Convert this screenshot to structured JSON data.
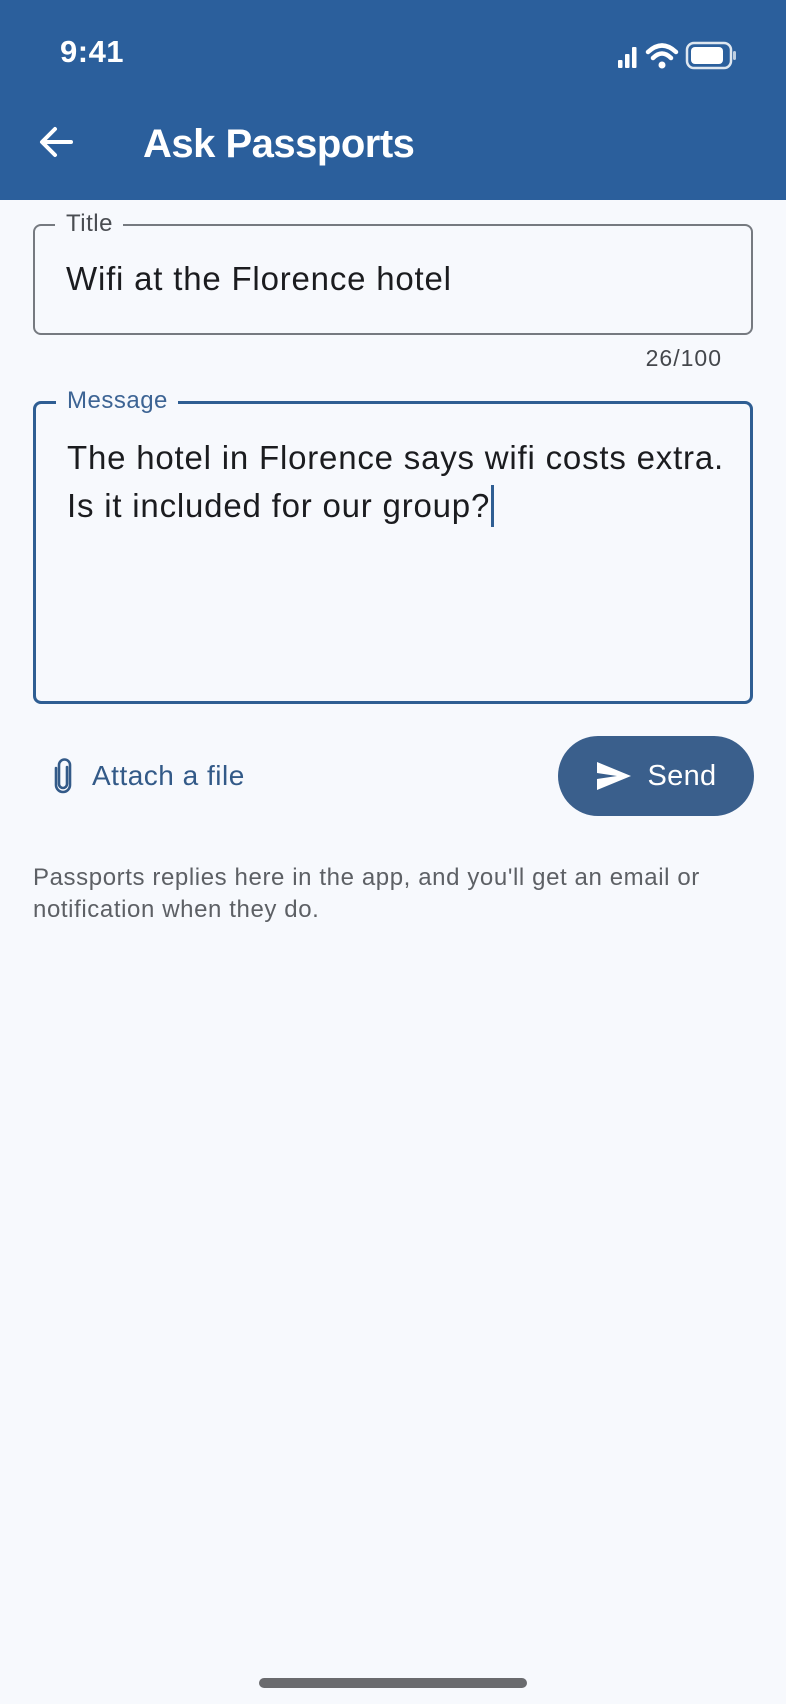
{
  "status_bar": {
    "time": "9:41",
    "icons": [
      "cellular-signal-icon",
      "wifi-icon",
      "battery-icon"
    ]
  },
  "app_bar": {
    "title": "Ask Passports",
    "back_icon": "arrow-back-icon",
    "background_color": "#2b5f9c"
  },
  "form": {
    "title_field": {
      "label": "Title",
      "value": "Wifi at the Florence hotel",
      "counter": "26/100"
    },
    "message_field": {
      "label": "Message",
      "value": "The hotel in Florence says wifi costs extra.\nIs it included for our group?",
      "focused": true
    },
    "attach_button": {
      "label": "Attach a file",
      "icon": "paperclip-icon"
    },
    "send_button": {
      "label": "Send",
      "icon": "send-icon",
      "color": "#3a5f8c"
    },
    "helper_text": "Passports replies here in the app, and you'll get an email or notification when they do."
  }
}
